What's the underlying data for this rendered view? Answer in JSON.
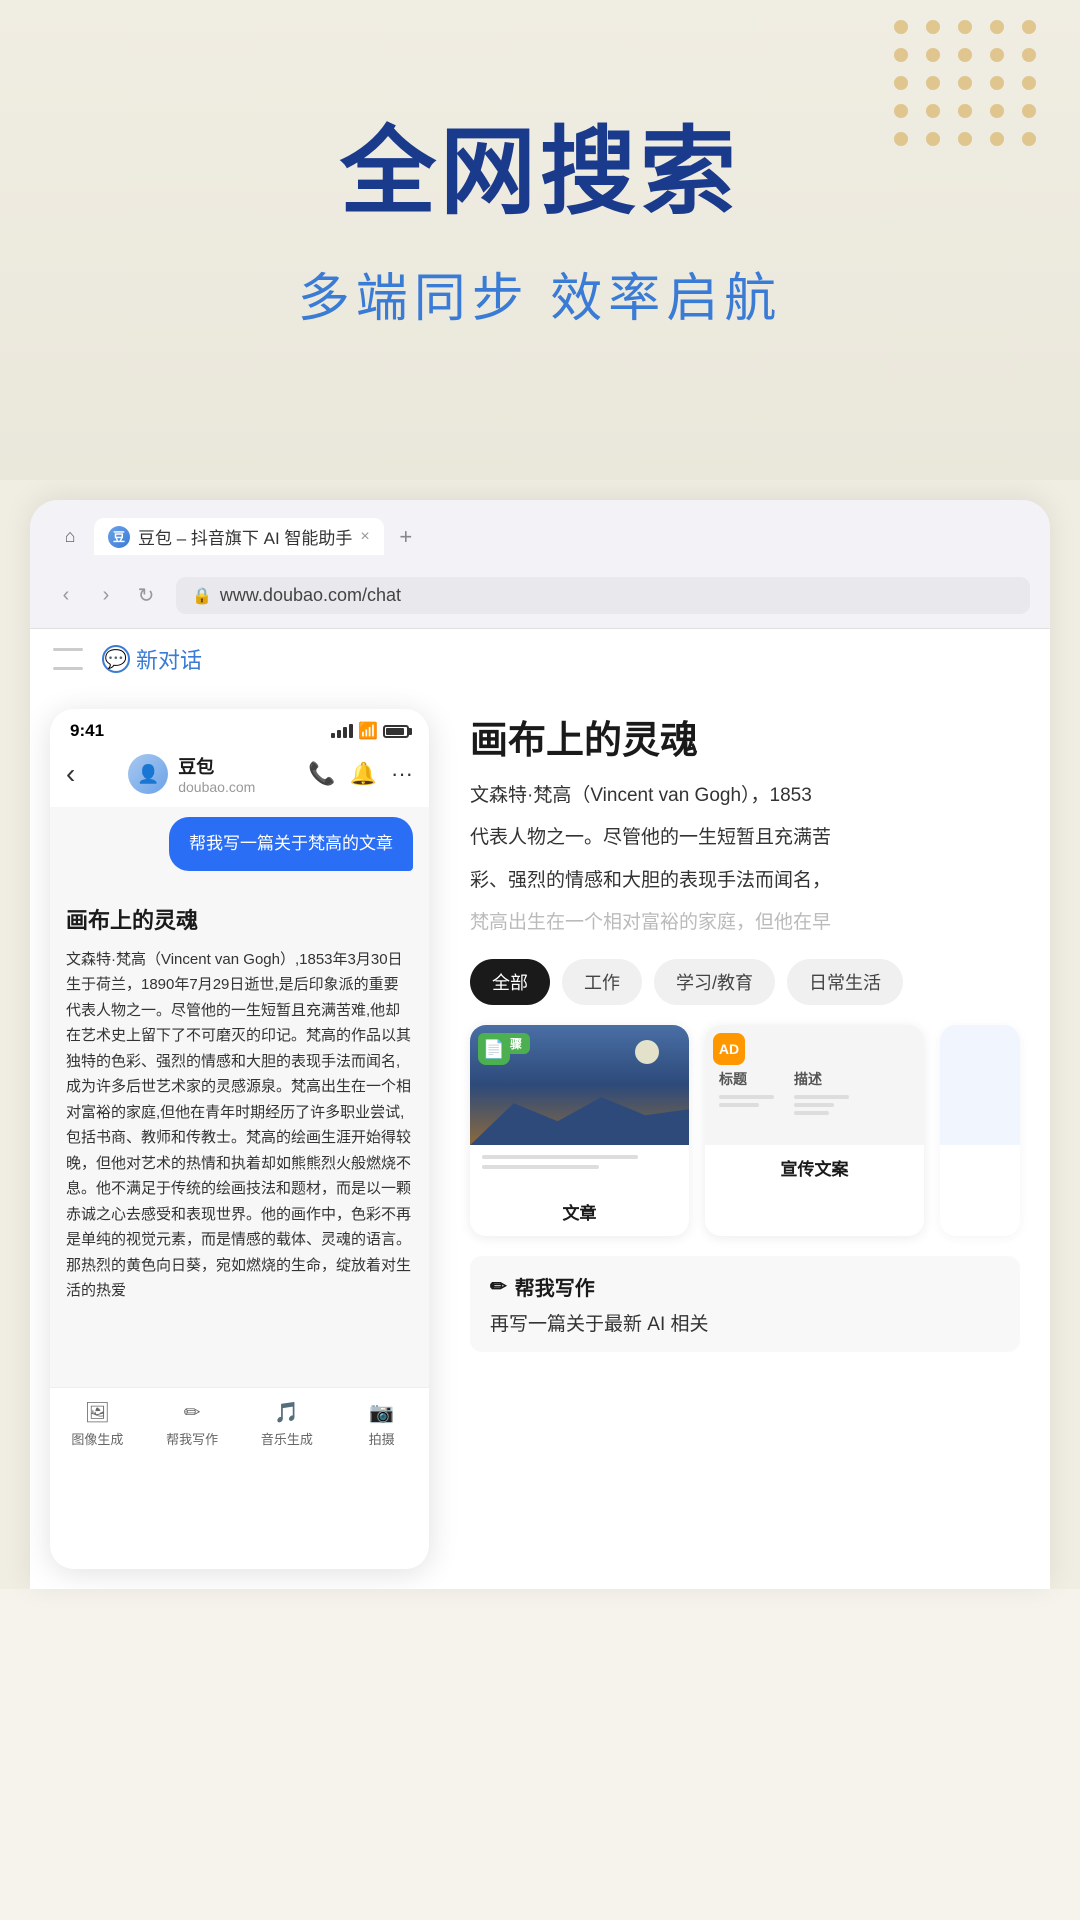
{
  "hero": {
    "title": "全网搜索",
    "subtitle": "多端同步 效率启航"
  },
  "browser": {
    "tab_favicon_text": "豆",
    "tab_title": "豆包 – 抖音旗下 AI 智能助手",
    "tab_close_label": "×",
    "tab_new_label": "+",
    "address_url": "www.doubao.com/chat",
    "new_chat_label": "新对话"
  },
  "mobile": {
    "time": "9:41",
    "chat_name": "豆包",
    "chat_url": "doubao.com",
    "user_message": "帮我写一篇关于梵高的文章",
    "article_title": "画布上的灵魂",
    "article_text": "文森特·梵高（Vincent van Gogh）,1853年3月30日生于荷兰，1890年7月29日逝世,是后印象派的重要代表人物之一。尽管他的一生短暂且充满苦难,他却在艺术史上留下了不可磨灭的印记。梵高的作品以其独特的色彩、强烈的情感和大胆的表现手法而闻名,成为许多后世艺术家的灵感源泉。梵高出生在一个相对富裕的家庭,但他在青年时期经历了许多职业尝试,包括书商、教师和传教士。梵高的绘画生涯开始得较晚，但他对艺术的热情和执着却如熊熊烈火般燃烧不息。他不满足于传统的绘画技法和题材，而是以一颗赤诚之心去感受和表现世界。他的画作中，色彩不再是单纯的视觉元素，而是情感的载体、灵魂的语言。那热烈的黄色向日葵，宛如燃烧的生命，绽放着对生活的热爱",
    "bottom_tabs": [
      {
        "icon": "🖼",
        "label": "图像生成"
      },
      {
        "icon": "✏",
        "label": "帮我写作"
      },
      {
        "icon": "🎵",
        "label": "音乐生成"
      },
      {
        "icon": "📷",
        "label": "拍摄"
      }
    ]
  },
  "right": {
    "article_title": "画布上的灵魂",
    "article_preview": "文森特·梵高（Vincent van Gogh），185",
    "article_preview2": "代表人物之一。尽管他的一生短暂且充满苦",
    "article_preview3": "彩、强烈的情感和大胆的表现手法而闻名，",
    "article_fade": "梵高出生在一个相对富裕的家庭，但他在早",
    "category_tabs": [
      {
        "label": "全部",
        "active": true
      },
      {
        "label": "工作",
        "active": false
      },
      {
        "label": "学习/教育",
        "active": false
      },
      {
        "label": "日常生活",
        "active": false
      }
    ],
    "card1": {
      "badge": "分步骤",
      "name": "文章"
    },
    "card2": {
      "badge": "AD",
      "label1": "标题",
      "label2": "描述",
      "name": "宣传文案"
    },
    "write_section": {
      "icon": "✏",
      "title": "帮我写作",
      "subtitle": "再写一篇关于最新 AI 相关"
    }
  },
  "colors": {
    "accent_blue": "#2a6ef5",
    "text_blue": "#1a3a8c",
    "subtitle_blue": "#3a7bd5",
    "dot_gold": "#d4a84b"
  }
}
